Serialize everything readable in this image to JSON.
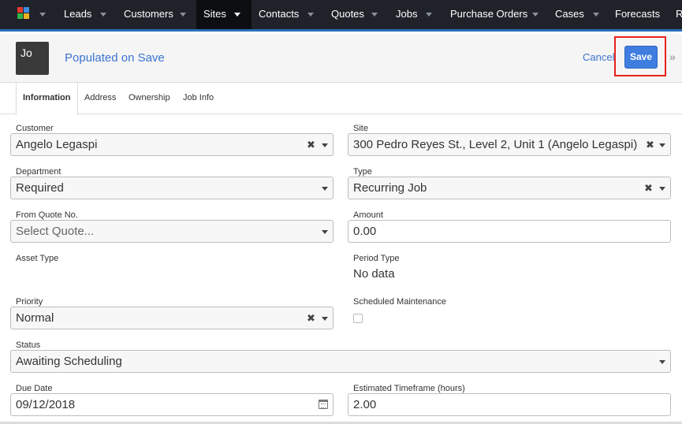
{
  "nav": {
    "items": [
      "Leads",
      "Customers",
      "Sites",
      "Contacts",
      "Quotes",
      "Jobs",
      "Purchase Orders",
      "Cases",
      "Forecasts",
      "R"
    ],
    "active": "Sites",
    "logo_colors": [
      "#e23b2e",
      "#3a8ee6",
      "#35b04a",
      "#f0b323"
    ]
  },
  "header": {
    "avatar_text": "Jo",
    "title": "Populated on Save",
    "cancel_label": "Cancel",
    "save_label": "Save",
    "expand_icon": "»"
  },
  "tabs": [
    "Information",
    "Address",
    "Ownership",
    "Job Info"
  ],
  "form": {
    "customer": {
      "label": "Customer",
      "value": "Angelo Legaspi"
    },
    "site": {
      "label": "Site",
      "value": "300 Pedro Reyes St., Level 2, Unit 1 (Angelo Legaspi)"
    },
    "department": {
      "label": "Department",
      "value": "Required"
    },
    "type": {
      "label": "Type",
      "value": "Recurring Job"
    },
    "from_quote": {
      "label": "From Quote No.",
      "placeholder": "Select Quote..."
    },
    "amount": {
      "label": "Amount",
      "value": "0.00"
    },
    "asset_type": {
      "label": "Asset Type"
    },
    "period_type": {
      "label": "Period Type",
      "value": "No data"
    },
    "priority": {
      "label": "Priority",
      "value": "Normal"
    },
    "scheduled_maintenance": {
      "label": "Scheduled Maintenance",
      "checked": false
    },
    "status": {
      "label": "Status",
      "value": "Awaiting Scheduling"
    },
    "due_date": {
      "label": "Due Date",
      "value": "09/12/2018"
    },
    "estimated_timeframe": {
      "label": "Estimated Timeframe (hours)",
      "value": "2.00"
    }
  },
  "icons": {
    "clear": "✖"
  },
  "colors": {
    "accent": "#3b74d1",
    "save_button": "#3f7ee0",
    "highlight": "#e8231a",
    "nav_bg": "#1f2229"
  }
}
